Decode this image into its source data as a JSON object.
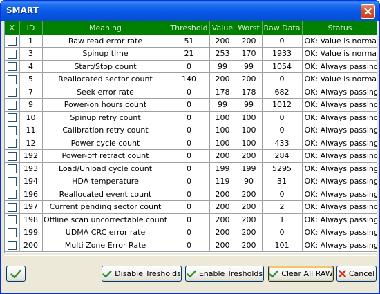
{
  "window": {
    "title": "SMART"
  },
  "table": {
    "headers": [
      "X",
      "ID",
      "Meaning",
      "Threshold",
      "Value",
      "Worst",
      "Raw Data",
      "Status"
    ],
    "rows": [
      {
        "id": "1",
        "meaning": "Raw read error rate",
        "threshold": "51",
        "value": "200",
        "worst": "200",
        "raw": "0",
        "status": "OK: Value is normal"
      },
      {
        "id": "3",
        "meaning": "Spinup time",
        "threshold": "21",
        "value": "253",
        "worst": "170",
        "raw": "1933",
        "status": "OK: Value is normal"
      },
      {
        "id": "4",
        "meaning": "Start/Stop count",
        "threshold": "0",
        "value": "99",
        "worst": "99",
        "raw": "1054",
        "status": "OK: Always passing"
      },
      {
        "id": "5",
        "meaning": "Reallocated sector count",
        "threshold": "140",
        "value": "200",
        "worst": "200",
        "raw": "0",
        "status": "OK: Value is normal"
      },
      {
        "id": "7",
        "meaning": "Seek error rate",
        "threshold": "0",
        "value": "178",
        "worst": "178",
        "raw": "682",
        "status": "OK: Always passing"
      },
      {
        "id": "9",
        "meaning": "Power-on hours count",
        "threshold": "0",
        "value": "99",
        "worst": "99",
        "raw": "1012",
        "status": "OK: Always passing"
      },
      {
        "id": "10",
        "meaning": "Spinup retry count",
        "threshold": "0",
        "value": "100",
        "worst": "100",
        "raw": "0",
        "status": "OK: Always passing"
      },
      {
        "id": "11",
        "meaning": "Calibration retry count",
        "threshold": "0",
        "value": "100",
        "worst": "100",
        "raw": "0",
        "status": "OK: Always passing"
      },
      {
        "id": "12",
        "meaning": "Power cycle count",
        "threshold": "0",
        "value": "100",
        "worst": "100",
        "raw": "433",
        "status": "OK: Always passing"
      },
      {
        "id": "192",
        "meaning": "Power-off retract count",
        "threshold": "0",
        "value": "200",
        "worst": "200",
        "raw": "284",
        "status": "OK: Always passing"
      },
      {
        "id": "193",
        "meaning": "Load/Unload cycle count",
        "threshold": "0",
        "value": "199",
        "worst": "199",
        "raw": "5295",
        "status": "OK: Always passing"
      },
      {
        "id": "194",
        "meaning": "HDA temperature",
        "threshold": "0",
        "value": "119",
        "worst": "90",
        "raw": "31",
        "status": "OK: Always passing"
      },
      {
        "id": "196",
        "meaning": "Reallocated event count",
        "threshold": "0",
        "value": "200",
        "worst": "200",
        "raw": "0",
        "status": "OK: Always passing"
      },
      {
        "id": "197",
        "meaning": "Current pending sector count",
        "threshold": "0",
        "value": "200",
        "worst": "200",
        "raw": "2",
        "status": "OK: Always passing"
      },
      {
        "id": "198",
        "meaning": "Offline scan uncorrectable count",
        "threshold": "0",
        "value": "200",
        "worst": "200",
        "raw": "1",
        "status": "OK: Always passing"
      },
      {
        "id": "199",
        "meaning": "UDMA CRC error rate",
        "threshold": "0",
        "value": "200",
        "worst": "200",
        "raw": "0",
        "status": "OK: Always passing"
      },
      {
        "id": "200",
        "meaning": "Multi Zone Error Rate",
        "threshold": "0",
        "value": "200",
        "worst": "200",
        "raw": "101",
        "status": "OK: Always passing"
      }
    ]
  },
  "buttons": {
    "ok_icon": "checkmark-icon",
    "disable_thresholds": "Disable Tresholds",
    "enable_thresholds": "Enable Tresholds",
    "clear_all_raw": "Clear All RAW",
    "cancel": "Cancel"
  },
  "colors": {
    "header_bg": "#008000",
    "header_text": "#d8e8d0",
    "titlebar": "#0858e6",
    "check_green": "#2e8b2e",
    "cancel_red": "#d42a1a"
  }
}
